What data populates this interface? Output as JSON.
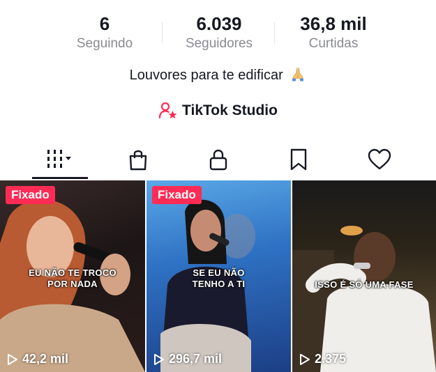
{
  "stats": {
    "following": {
      "value": "6",
      "label": "Seguindo"
    },
    "followers": {
      "value": "6.039",
      "label": "Seguidores"
    },
    "likes": {
      "value": "36,8 mil",
      "label": "Curtidas"
    }
  },
  "bio": {
    "text": "Louvores para te edificar",
    "emoji_icon": "praying-hands-icon"
  },
  "studio": {
    "label": "TikTok Studio",
    "icon": "creator-star-icon"
  },
  "tabs": [
    {
      "name": "videos",
      "icon": "grid-sort-icon",
      "active": true
    },
    {
      "name": "shop",
      "icon": "bag-icon",
      "active": false
    },
    {
      "name": "private",
      "icon": "lock-icon",
      "active": false
    },
    {
      "name": "favorites",
      "icon": "bookmark-icon",
      "active": false
    },
    {
      "name": "liked",
      "icon": "heart-icon",
      "active": false
    }
  ],
  "videos": [
    {
      "pinned_label": "Fixado",
      "caption_line1": "EU NÃO TE TROCO",
      "caption_line2": "POR NADA",
      "views": "42,2 mil"
    },
    {
      "pinned_label": "Fixado",
      "caption_line1": "SE EU NÃO",
      "caption_line2": "TENHO A TI",
      "views": "296,7 mil"
    },
    {
      "pinned_label": "",
      "caption_line1": "ISSO É SÓ UMA FASE",
      "caption_line2": "",
      "views": "2.375"
    }
  ],
  "colors": {
    "accent": "#fe2c55",
    "text": "#161823",
    "muted": "#8a8b91"
  }
}
